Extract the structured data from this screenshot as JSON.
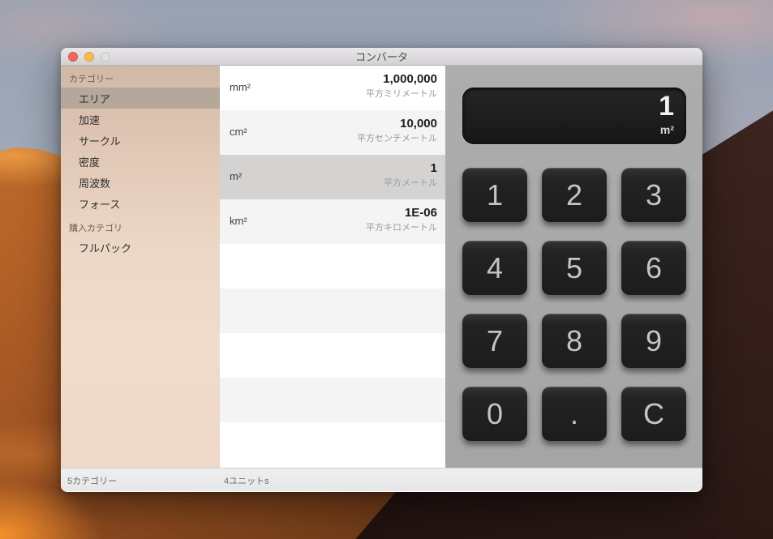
{
  "window": {
    "title": "コンバータ",
    "traffic_lights": {
      "close": "close",
      "minimize": "minimize",
      "zoom": "zoom-disabled"
    }
  },
  "sidebar": {
    "sections": [
      {
        "header": "カテゴリー",
        "items": [
          {
            "label": "エリア",
            "selected": true
          },
          {
            "label": "加速",
            "selected": false
          },
          {
            "label": "サークル",
            "selected": false
          },
          {
            "label": "密度",
            "selected": false
          },
          {
            "label": "周波数",
            "selected": false
          },
          {
            "label": "フォース",
            "selected": false
          }
        ]
      },
      {
        "header": "購入カテゴリ",
        "items": [
          {
            "label": "フルパック",
            "selected": false
          }
        ]
      }
    ]
  },
  "unit_list": {
    "rows": [
      {
        "symbol": "mm²",
        "value": "1,000,000",
        "name": "平方ミリメートル",
        "selected": false
      },
      {
        "symbol": "cm²",
        "value": "10,000",
        "name": "平方センチメートル",
        "selected": false
      },
      {
        "symbol": "m²",
        "value": "1",
        "name": "平方メートル",
        "selected": true
      },
      {
        "symbol": "km²",
        "value": "1E-06",
        "name": "平方キロメートル",
        "selected": false
      }
    ]
  },
  "calculator": {
    "display": {
      "value": "1",
      "unit": "m²"
    },
    "keys": [
      "1",
      "2",
      "3",
      "4",
      "5",
      "6",
      "7",
      "8",
      "9",
      "0",
      ".",
      "C"
    ]
  },
  "statusbar": {
    "categories_count": "5カテゴリー",
    "units_count": "4ユニットs"
  },
  "colors": {
    "traffic_close": "#ee6a5e",
    "traffic_min": "#f5bd4f",
    "traffic_zoom_disabled": "#dfdfdf",
    "sidebar_selected": "#b5a79a",
    "row_selected": "#d5d3d2",
    "calc_panel": "#a8a8a8",
    "key_bg": "#1e1e1e"
  }
}
